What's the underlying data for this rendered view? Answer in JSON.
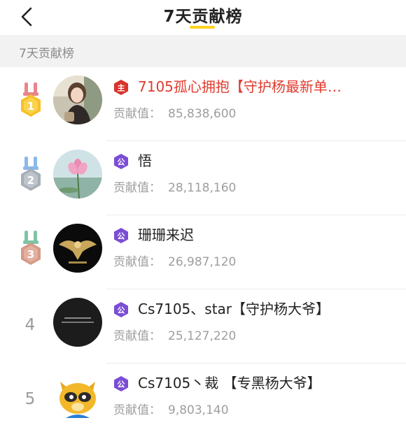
{
  "header": {
    "title": "7天贡献榜",
    "back_icon": "chevron-left-icon",
    "accent_color": "#FFD21E"
  },
  "section": {
    "label": "7天贡献榜"
  },
  "contrib_label": "贡献值：",
  "rows": [
    {
      "rank": "1",
      "medal": "gold",
      "badge": "主",
      "badge_color": "#D9332B",
      "name": "7105孤心拥抱【守护杨最新单…",
      "name_color": "#E23B2E",
      "value": "85,838,600",
      "avatar": "portrait-photo"
    },
    {
      "rank": "2",
      "medal": "silver",
      "badge": "公",
      "badge_color": "#7B4DD6",
      "name": "悟",
      "name_color": "#222222",
      "value": "28,118,160",
      "avatar": "lotus-flower"
    },
    {
      "rank": "3",
      "medal": "bronze",
      "badge": "公",
      "badge_color": "#7B4DD6",
      "name": "珊珊来迟",
      "name_color": "#222222",
      "value": "26,987,120",
      "avatar": "eagle-emblem"
    },
    {
      "rank": "4",
      "medal": "",
      "badge": "公",
      "badge_color": "#7B4DD6",
      "name": "Cs7105、star【守护杨大爷】",
      "name_color": "#222222",
      "value": "25,127,220",
      "avatar": "dark-text"
    },
    {
      "rank": "5",
      "medal": "",
      "badge": "公",
      "badge_color": "#7B4DD6",
      "name": "Cs7105丶裁 【专黑杨大爷】",
      "name_color": "#222222",
      "value": "9,803,140",
      "avatar": "raccoon-mascot"
    }
  ]
}
